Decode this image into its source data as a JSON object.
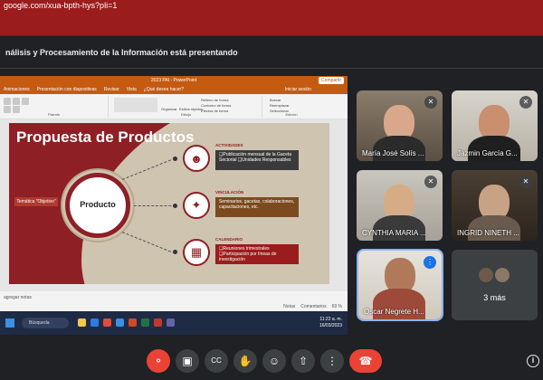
{
  "browser": {
    "url": "google.com/xua-bpth-hys?pli=1",
    "accent": "#9b1c1c"
  },
  "banner": {
    "text": "nálisis y Procesamiento de la Información está presentando"
  },
  "powerpoint": {
    "window_title": "2023 PAI - PowerPoint",
    "share_label": "Compartir",
    "menu": [
      "Animaciones",
      "Presentación con diapositivas",
      "Revisar",
      "Vista",
      "¿Qué desea hacer?",
      "Iniciar sesión"
    ],
    "ribbon": {
      "groups": [
        "Párrafo",
        "Dibujo",
        "Edición"
      ],
      "commands": [
        "Organizar",
        "Estilos rápidos",
        "Relleno de forma",
        "Contorno de forma",
        "Efectos de forma",
        "Buscar",
        "Reemplazar",
        "Seleccionar"
      ]
    },
    "slide": {
      "heading": "Propuesta de Productos",
      "center_label": "Producto",
      "side_label": "Temática \"Objetivo\"",
      "sections": [
        {
          "title": "ACTIVIDADES",
          "text": "❑Publicación mensual de la Gaceta Sectorial ❑Unidades Responsables",
          "icon": "people-group-icon"
        },
        {
          "title": "VINCULACIÓN",
          "text": "Seminarios, gacetas, colaboraciones, capacitaciones, etc.",
          "icon": "network-icon"
        },
        {
          "title": "CALENDARIO",
          "text": "❑Reuniones trimestrales ❑Participación por líneas de investigación",
          "icon": "calendar-icon"
        }
      ]
    },
    "status": {
      "notes": "agregar notas",
      "notes_btn": "Notas",
      "comments_btn": "Comentarios",
      "zoom": "69 %"
    }
  },
  "taskbar": {
    "search": "Búsqueda",
    "lang": "ESP\nLAA",
    "time": "11:22 a. m.",
    "date": "16/03/2023"
  },
  "participants": [
    {
      "name": "María José Solís ...",
      "muted": true
    },
    {
      "name": "Jazmin García G...",
      "muted": true
    },
    {
      "name": "CYNTHIA MARIA ...",
      "muted": true
    },
    {
      "name": "INGRID NINETH ...",
      "muted": true
    },
    {
      "name": "Oscar Negrete H...",
      "muted": false
    }
  ],
  "more_participants": "3 más",
  "controls": [
    "mic-off",
    "camera",
    "captions",
    "raise-hand",
    "emoji",
    "present",
    "more",
    "end-call"
  ],
  "colors": {
    "meet_bg": "#202124",
    "control_bg": "#3c4043",
    "end_call": "#ea4335",
    "slide_red": "#8e1f25",
    "slide_beige": "#cfc4b0",
    "ppt_orange": "#c55a11"
  }
}
